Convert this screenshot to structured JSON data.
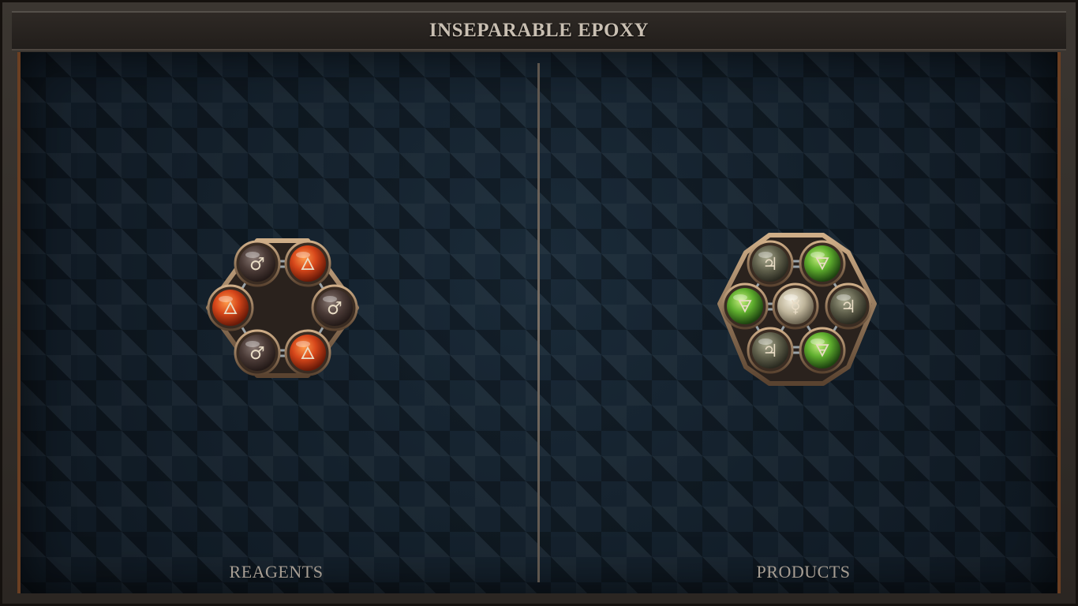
{
  "puzzle": {
    "title": "INSEPARABLE EPOXY"
  },
  "panels": {
    "reagents_label": "REAGENTS",
    "products_label": "PRODUCTS"
  },
  "colors": {
    "salt_ball": "#4a3a36",
    "fire_ball": "#d6461a",
    "earth_ball": "#6fbf3c",
    "tin_ball": "#6b6b55",
    "mercury_ball": "#c9c0a8",
    "glyph": "#e9dcc5"
  },
  "reagent": {
    "atoms": [
      {
        "element": "iron",
        "symbol": "♂"
      },
      {
        "element": "fire",
        "symbol": "🜂"
      },
      {
        "element": "iron",
        "symbol": "♂"
      },
      {
        "element": "fire",
        "symbol": "🜂"
      },
      {
        "element": "iron",
        "symbol": "♂"
      },
      {
        "element": "fire",
        "symbol": "🜂"
      }
    ]
  },
  "product": {
    "atoms": [
      {
        "element": "tin",
        "symbol": "♃"
      },
      {
        "element": "earth",
        "symbol": "🜃"
      },
      {
        "element": "tin",
        "symbol": "♃"
      },
      {
        "element": "earth",
        "symbol": "🜃"
      },
      {
        "element": "tin",
        "symbol": "♃"
      },
      {
        "element": "earth",
        "symbol": "🜃"
      },
      {
        "element": "mercury",
        "symbol": "☿"
      }
    ]
  }
}
